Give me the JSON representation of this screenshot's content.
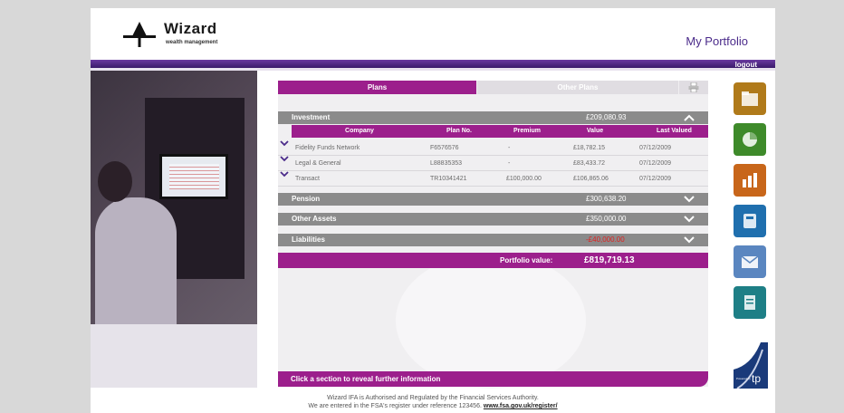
{
  "brand": {
    "name": "Wizard",
    "tagline": "wealth management"
  },
  "header": {
    "title": "My Portfolio",
    "logout": "logout"
  },
  "tabs": [
    {
      "label": "Plans",
      "active": true
    },
    {
      "label": "Other Plans",
      "active": false
    }
  ],
  "investment": {
    "label": "Investment",
    "amount": "£209,080.93",
    "columns": [
      "Company",
      "Plan No.",
      "Premium",
      "Value",
      "Last Valued"
    ],
    "rows": [
      {
        "company": "Fidelity Funds Network",
        "plan_no": "F6576576",
        "premium": "-",
        "value": "£18,782.15",
        "last_valued": "07/12/2009"
      },
      {
        "company": "Legal & General",
        "plan_no": "L88835353",
        "premium": "-",
        "value": "£83,433.72",
        "last_valued": "07/12/2009"
      },
      {
        "company": "Transact",
        "plan_no": "TR10341421",
        "premium": "£100,000.00",
        "value": "£106,865.06",
        "last_valued": "07/12/2009"
      }
    ]
  },
  "sections": [
    {
      "label": "Pension",
      "amount": "£300,638.20"
    },
    {
      "label": "Other Assets",
      "amount": "£350,000.00"
    },
    {
      "label": "Liabilities",
      "amount": "-£40,000.00"
    }
  ],
  "portfolio": {
    "label": "Portfolio value:",
    "value": "£819,719.13"
  },
  "hint": "Click a section to reveal further information",
  "icons": [
    {
      "name": "folder-icon",
      "color": "#b07a1a"
    },
    {
      "name": "pie-chart-icon",
      "color": "#3e8a2a"
    },
    {
      "name": "bar-chart-icon",
      "color": "#c8661a"
    },
    {
      "name": "calculator-icon",
      "color": "#1f6fae"
    },
    {
      "name": "envelope-icon",
      "color": "#5a86c0"
    },
    {
      "name": "document-icon",
      "color": "#1e7f86"
    }
  ],
  "powered_by": {
    "prefix": "Powered by",
    "mark": "tp"
  },
  "legal": {
    "line1": "Wizard IFA is Authorised and Regulated by the Financial Services Authority.",
    "line2": "We are entered in the FSA's register under reference 123456.",
    "link": "www.fsa.gov.uk/register/"
  },
  "colors": {
    "accent": "#9c1f8c",
    "section": "#8b8b8b",
    "topbar": "#4a2a7a",
    "negative": "#e02020"
  }
}
